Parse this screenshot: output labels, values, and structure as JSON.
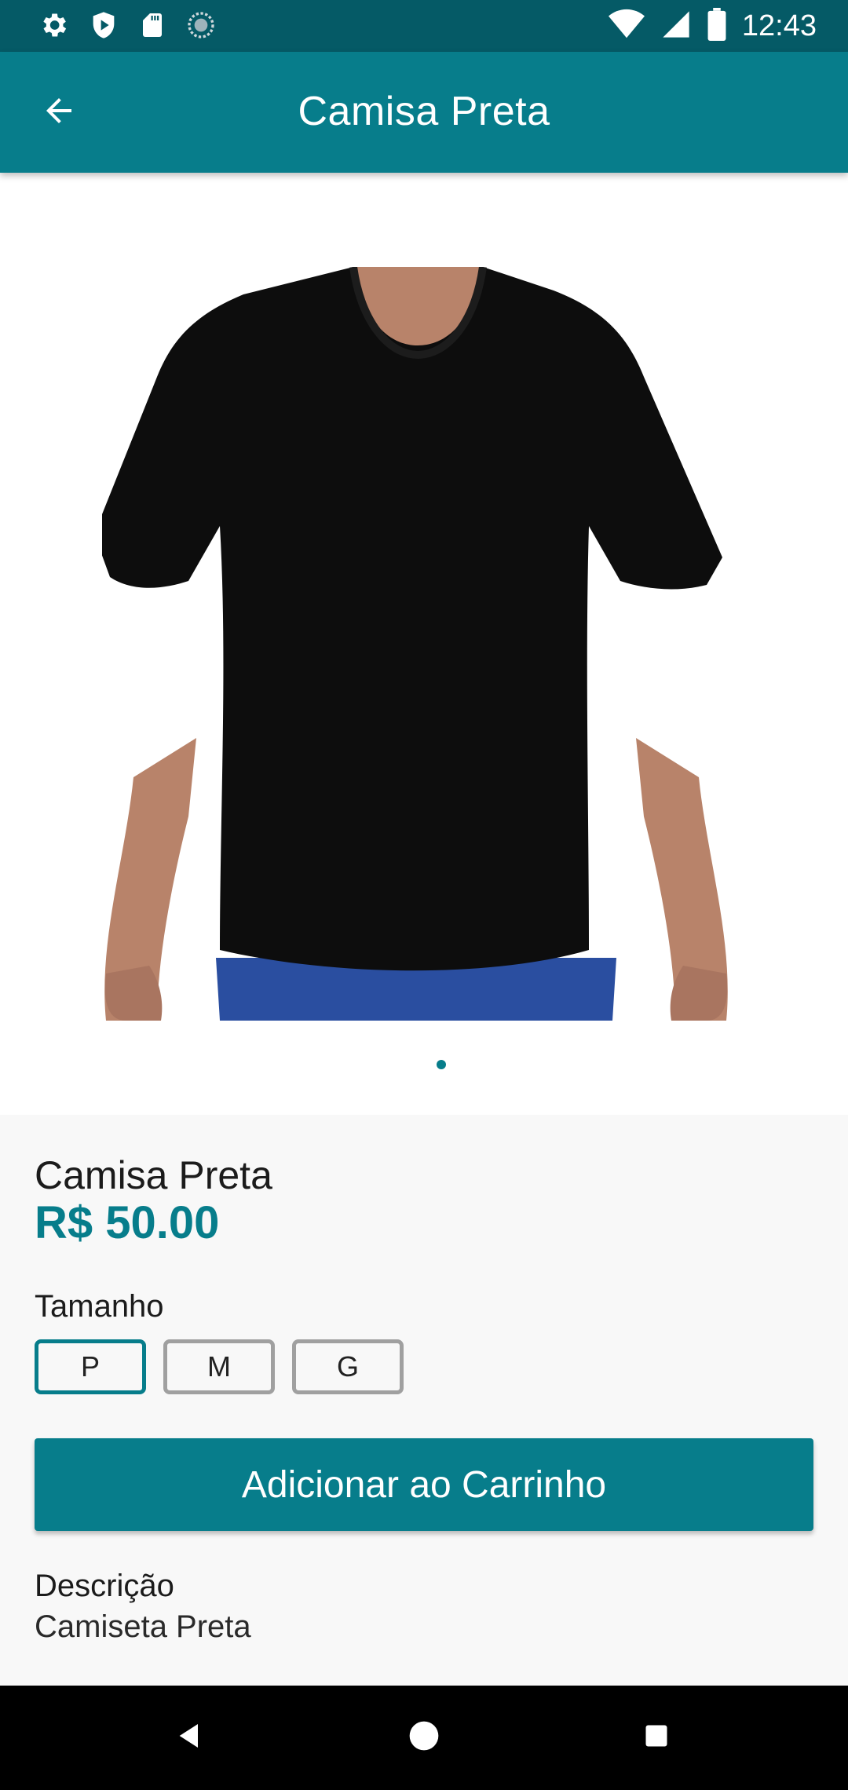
{
  "status_bar": {
    "time": "12:43",
    "left_icons": [
      "gear-icon",
      "shield-play-icon",
      "sd-card-icon",
      "circle-dots-icon"
    ],
    "right_icons": [
      "wifi-icon",
      "signal-icon",
      "battery-icon"
    ]
  },
  "app_bar": {
    "title": "Camisa Preta",
    "back_icon": "arrow-back-icon"
  },
  "gallery": {
    "image_description_icon": "black-tshirt-photo",
    "page_count": 1,
    "current_page": 1
  },
  "product": {
    "name": "Camisa Preta",
    "price": "R$ 50.00",
    "size_label": "Tamanho",
    "sizes": [
      "P",
      "M",
      "G"
    ],
    "selected_size": "P",
    "add_to_cart_label": "Adicionar ao Carrinho",
    "description_label": "Descrição",
    "description": "Camiseta Preta"
  },
  "colors": {
    "primary": "#077d8b",
    "status_bar": "#055a66",
    "background": "#f8f8f8"
  },
  "nav_bar": {
    "icons": [
      "back-triangle-icon",
      "home-circle-icon",
      "recents-square-icon"
    ]
  }
}
